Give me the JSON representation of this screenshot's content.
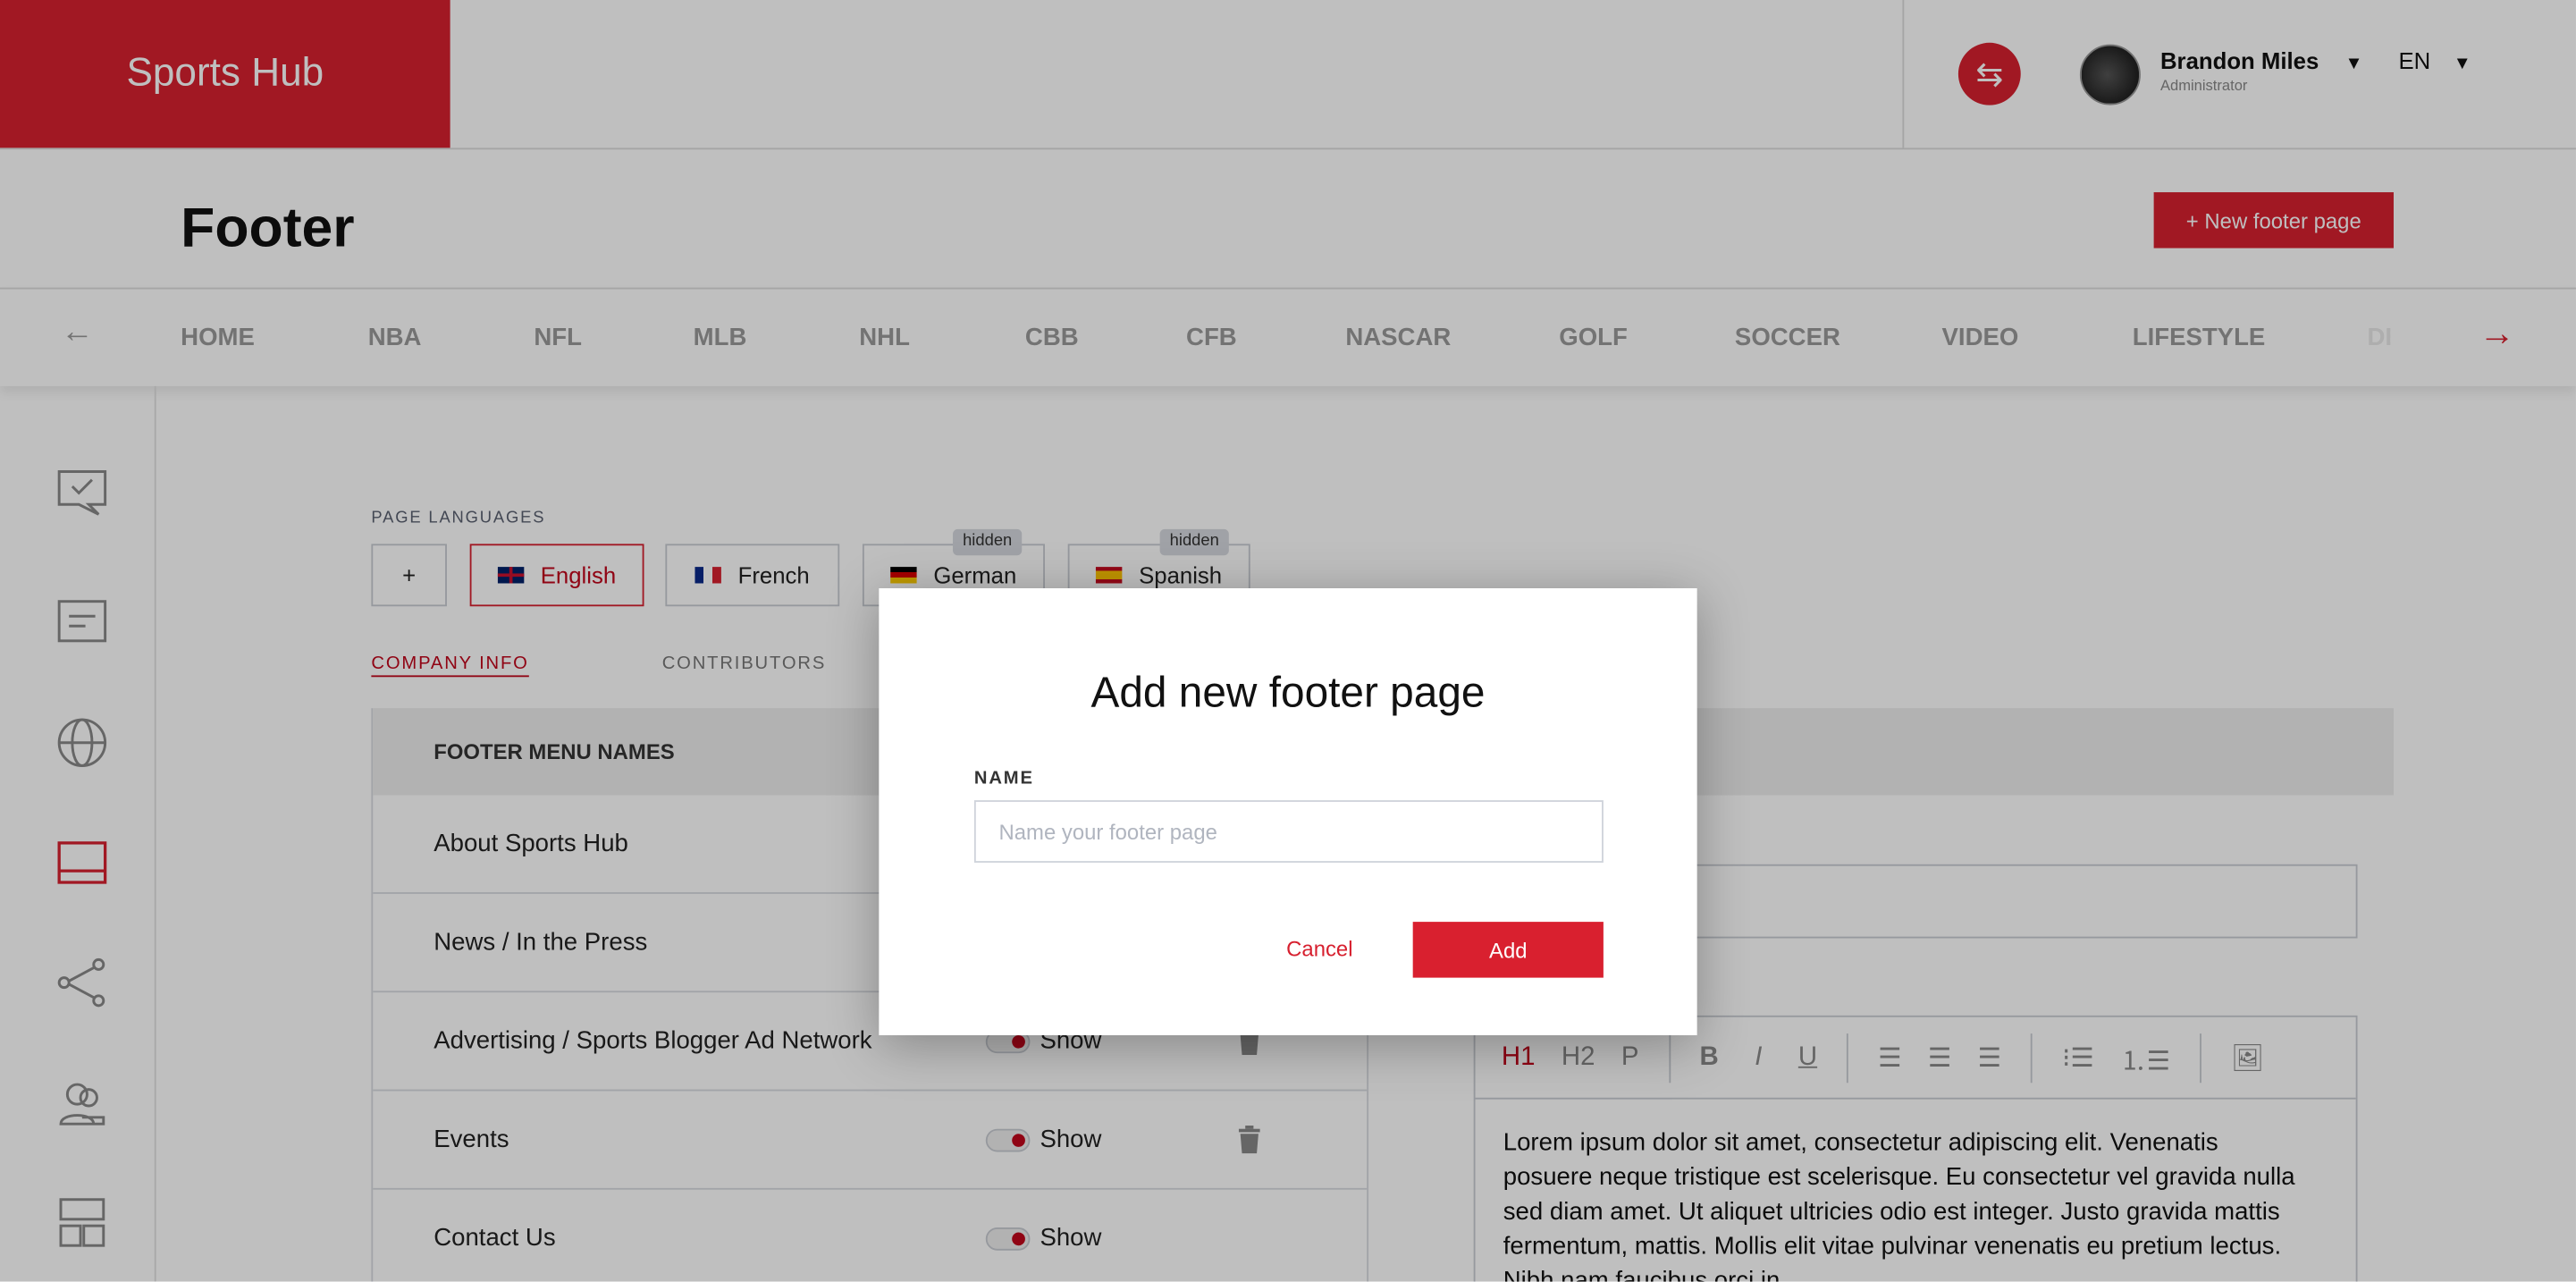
{
  "header": {
    "logo": "Sports Hub",
    "user_name": "Brandon Miles",
    "user_role": "Administrator",
    "language": "EN"
  },
  "page": {
    "title": "Footer",
    "new_button": "+ New footer page"
  },
  "nav": {
    "items": [
      "HOME",
      "NBA",
      "NFL",
      "MLB",
      "NHL",
      "CBB",
      "CFB",
      "NASCAR",
      "GOLF",
      "SOCCER",
      "VIDEO",
      "LIFESTYLE",
      "DE"
    ]
  },
  "languages": {
    "label": "PAGE LANGUAGES",
    "add": "+",
    "items": [
      {
        "name": "English",
        "active": true
      },
      {
        "name": "French"
      },
      {
        "name": "German",
        "badge": "hidden"
      },
      {
        "name": "Spanish",
        "badge": "hidden"
      }
    ]
  },
  "tabs": [
    "COMPANY INFO",
    "CONTRIBUTORS"
  ],
  "table": {
    "header": "FOOTER MENU NAMES",
    "rows": [
      {
        "name": "About Sports Hub"
      },
      {
        "name": "News / In the Press"
      },
      {
        "name": "Advertising / Sports Blogger Ad Network",
        "status": "Show"
      },
      {
        "name": "Events",
        "status": "Show"
      },
      {
        "name": "Contact Us",
        "status": "Show"
      }
    ]
  },
  "editor": {
    "toolbar": [
      "H1",
      "H2",
      "P",
      "B",
      "I",
      "U"
    ],
    "text": "Lorem ipsum dolor sit amet, consectetur adipiscing elit. Venenatis posuere neque tristique est scelerisque. Eu consectetur vel gravida nulla sed diam amet. Ut aliquet ultricies odio est integer. Justo gravida mattis fermentum, mattis. Mollis elit vitae pulvinar venenatis eu pretium lectus. Nibh nam faucibus orci in"
  },
  "modal": {
    "title": "Add new footer page",
    "name_label": "NAME",
    "name_placeholder": "Name your footer page",
    "name_value": "",
    "cancel": "Cancel",
    "add": "Add"
  },
  "colors": {
    "brand": "#d7202f"
  }
}
